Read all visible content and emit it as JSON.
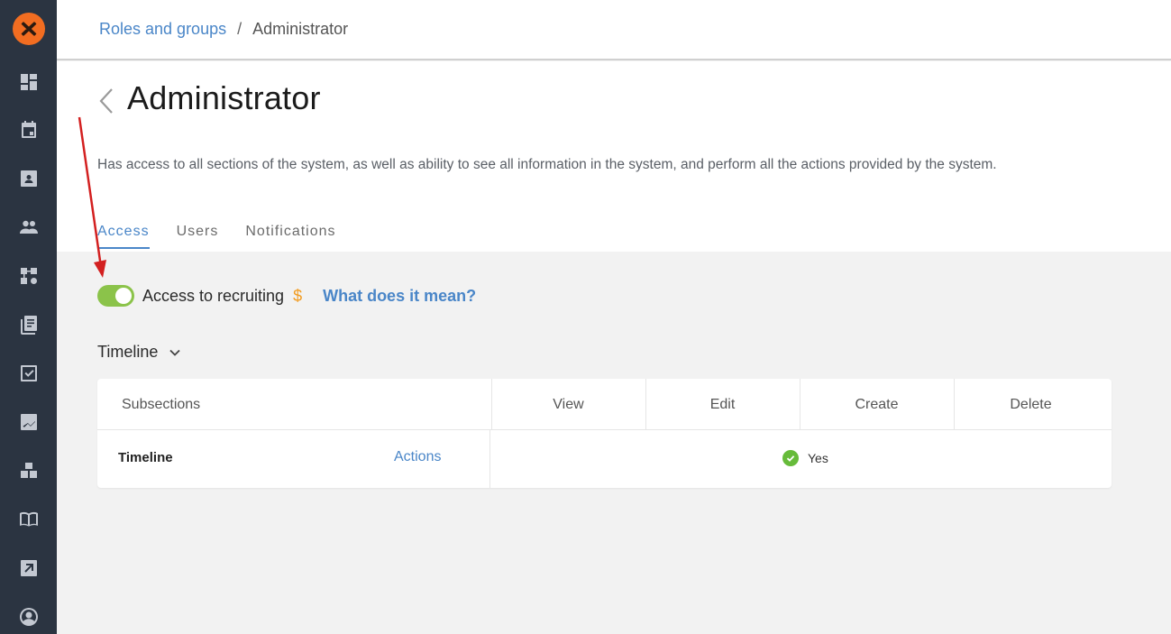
{
  "sidebar": {
    "logo_icon": "x-logo-icon",
    "items": [
      {
        "icon": "dashboard-icon"
      },
      {
        "icon": "calendar-icon"
      },
      {
        "icon": "contact-card-icon"
      },
      {
        "icon": "people-icon"
      },
      {
        "icon": "workflow-icon"
      },
      {
        "icon": "library-icon"
      },
      {
        "icon": "checklist-icon"
      },
      {
        "icon": "chart-icon"
      },
      {
        "icon": "boxes-icon"
      },
      {
        "icon": "book-icon"
      },
      {
        "icon": "external-link-icon"
      },
      {
        "icon": "account-icon"
      }
    ],
    "colors": {
      "background": "#2b3441",
      "icon": "#c3c8d1",
      "logo": "#f26d21"
    }
  },
  "breadcrumb": {
    "parent": "Roles and groups",
    "separator": "/",
    "current": "Administrator"
  },
  "page": {
    "title": "Administrator",
    "description": "Has access to all sections of the system, as well as ability to see all information in the system, and perform all the actions provided by the system."
  },
  "tabs": [
    {
      "label": "Access",
      "active": true
    },
    {
      "label": "Users",
      "active": false
    },
    {
      "label": "Notifications",
      "active": false
    }
  ],
  "access": {
    "toggle_on": true,
    "label": "Access to recruiting",
    "paid_symbol": "$",
    "help_link": "What does it mean?"
  },
  "section": {
    "title": "Timeline"
  },
  "table": {
    "headers": {
      "subsections": "Subsections",
      "view": "View",
      "edit": "Edit",
      "create": "Create",
      "delete": "Delete"
    },
    "rows": [
      {
        "name": "Timeline",
        "actions": "Actions",
        "value": "Yes"
      }
    ]
  },
  "colors": {
    "accent": "#4a86c8",
    "toggle": "#8bc34a",
    "dollar": "#f29c21",
    "check": "#66bb3a",
    "annotation_arrow": "#d32020"
  }
}
